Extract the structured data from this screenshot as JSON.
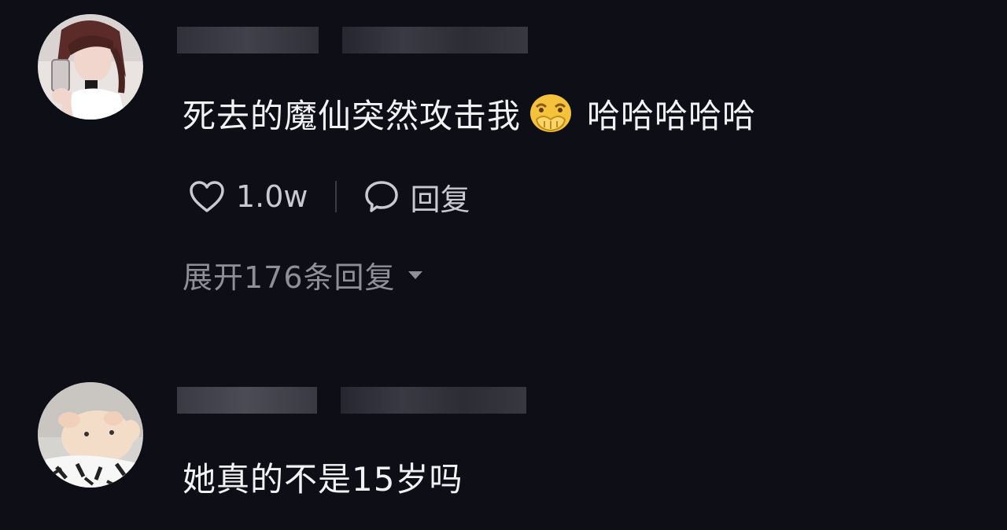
{
  "comments": [
    {
      "text_before_emoji": "死去的魔仙突然攻击我",
      "emoji": "hands-over-mouth-emoji",
      "text_after_emoji": "哈哈哈哈哈",
      "likes": "1.0w",
      "reply_label": "回复",
      "expand_label": "展开176条回复"
    },
    {
      "text": "她真的不是15岁吗"
    }
  ],
  "colors": {
    "background": "#0d0e16",
    "text": "#f2f2f4",
    "muted": "#8e8f97",
    "emoji": "#f5c33b"
  }
}
